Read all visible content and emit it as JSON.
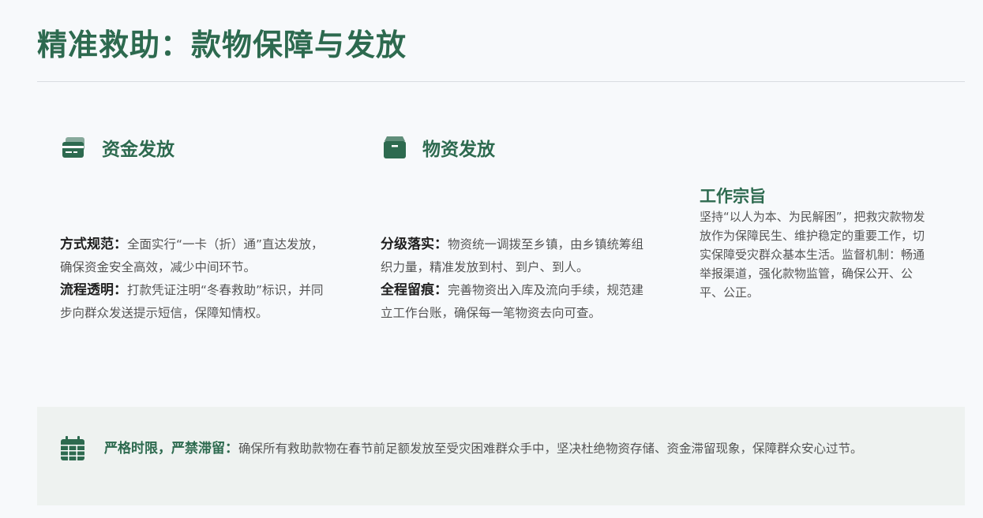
{
  "title": "精准救助：款物保障与发放",
  "sections": {
    "funds": {
      "title": "资金发放",
      "items": [
        {
          "label": "方式规范：",
          "text": "全面实行“一卡（折）通”直达发放，确保资金安全高效，减少中间环节。"
        },
        {
          "label": "流程透明：",
          "text": "打款凭证注明“冬春救助”标识，并同步向群众发送提示短信，保障知情权。"
        }
      ]
    },
    "supplies": {
      "title": "物资发放",
      "items": [
        {
          "label": "分级落实：",
          "text": "物资统一调拨至乡镇，由乡镇统筹组织力量，精准发放到村、到户、到人。"
        },
        {
          "label": "全程留痕：",
          "text": "完善物资出入库及流向手续，规范建立工作台账，确保每一笔物资去向可查。"
        }
      ]
    }
  },
  "aside": {
    "title": "工作宗旨",
    "text": "坚持“以人为本、为民解困”，把救灾款物发放作为保障民生、维护稳定的重要工作，切实保障受灾群众基本生活。监督机制：畅通举报渠道，强化款物监管，确保公开、公平、公正。"
  },
  "banner": {
    "label": "严格时限，严禁滞留：",
    "text": "确保所有救助款物在春节前足额发放至受灾困难群众手中，坚决杜绝物资存储、资金滞留现象，保障群众安心过节。"
  },
  "icons": {
    "funds": "card-icon",
    "supplies": "box-icon",
    "banner": "calendar-icon"
  },
  "colors": {
    "accent": "#2d6a4f",
    "background": "#f7f9fb",
    "banner_bg": "#eef2f0",
    "divider": "#d9dde1"
  }
}
